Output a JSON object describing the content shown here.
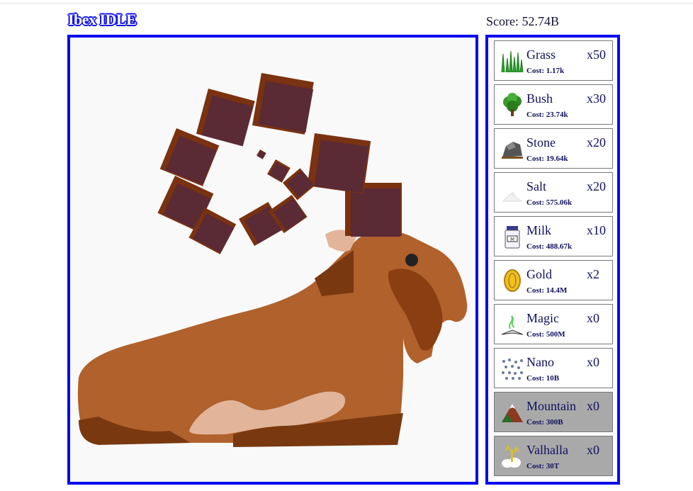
{
  "app": {
    "title": "Ibex IDLE"
  },
  "score": {
    "text": "Score: 52.74B"
  },
  "shop": {
    "items": [
      {
        "name": "Grass",
        "count": "x50",
        "cost": "Cost: 1.17k",
        "icon": "grass-icon",
        "locked": false
      },
      {
        "name": "Bush",
        "count": "x30",
        "cost": "Cost: 23.74k",
        "icon": "bush-icon",
        "locked": false
      },
      {
        "name": "Stone",
        "count": "x20",
        "cost": "Cost: 19.64k",
        "icon": "stone-icon",
        "locked": false
      },
      {
        "name": "Salt",
        "count": "x20",
        "cost": "Cost: 575.06k",
        "icon": "salt-icon",
        "locked": false
      },
      {
        "name": "Milk",
        "count": "x10",
        "cost": "Cost: 488.67k",
        "icon": "milk-icon",
        "locked": false
      },
      {
        "name": "Gold",
        "count": "x2",
        "cost": "Cost: 14.4M",
        "icon": "gold-icon",
        "locked": false
      },
      {
        "name": "Magic",
        "count": "x0",
        "cost": "Cost: 500M",
        "icon": "magic-icon",
        "locked": false
      },
      {
        "name": "Nano",
        "count": "x0",
        "cost": "Cost: 10B",
        "icon": "nano-icon",
        "locked": false
      },
      {
        "name": "Mountain",
        "count": "x0",
        "cost": "Cost: 300B",
        "icon": "mountain-icon",
        "locked": true
      },
      {
        "name": "Valhalla",
        "count": "x0",
        "cost": "Cost: 30T",
        "icon": "valhalla-icon",
        "locked": true
      }
    ]
  },
  "colors": {
    "border": "#0a0af0",
    "text": "#101060",
    "locked": "#a9a9a9",
    "ibex_body": "#b0612c",
    "ibex_dark": "#7a3810",
    "horn_front": "#5a2a35",
    "horn_side": "#7a3210"
  }
}
